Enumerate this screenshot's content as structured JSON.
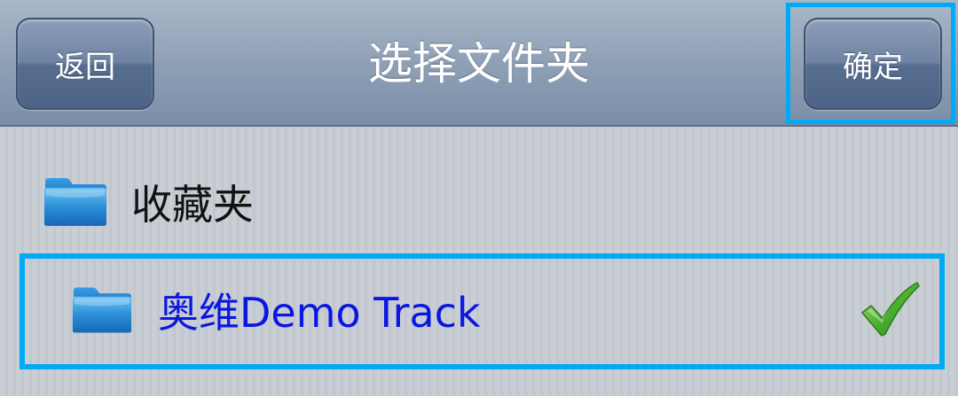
{
  "navbar": {
    "title": "选择文件夹",
    "back_label": "返回",
    "confirm_label": "确定"
  },
  "folders": [
    {
      "label": "收藏夹",
      "icon": "folder-icon",
      "selected": false
    },
    {
      "label": "奥维Demo Track",
      "icon": "folder-icon",
      "selected": true,
      "status_icon": "checkmark-icon"
    }
  ],
  "colors": {
    "accent_highlight": "#00aaf5",
    "selected_text": "#0a17e0",
    "checkmark": "#3ea42a"
  }
}
